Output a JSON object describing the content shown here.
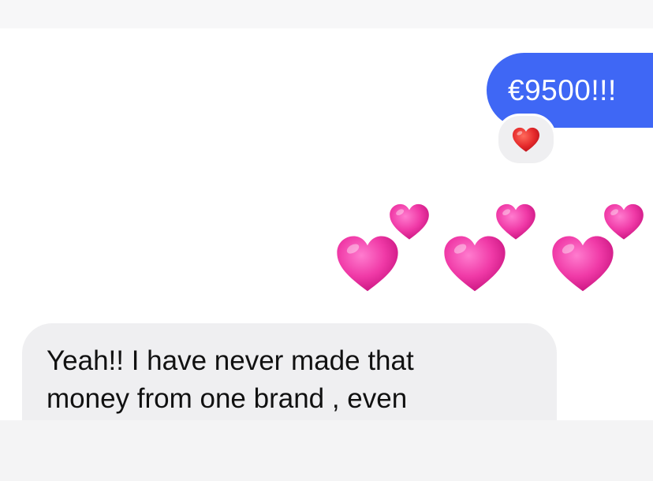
{
  "conversation": {
    "sent_message": {
      "text": "€9500!!!",
      "reaction": "red-heart"
    },
    "emoji_message": {
      "emoji": "pink-hearts",
      "count": 3
    },
    "received_message": {
      "line1": "Yeah!! I have never made that",
      "line2": "money from one brand , even"
    }
  },
  "colors": {
    "sent_bubble": "#3f67f5",
    "received_bubble": "#efeff1",
    "heart_pink": "#ee2f9e",
    "reaction_red": "#e0262b"
  },
  "icons": {
    "reaction": "red-heart-icon",
    "hearts": "two-hearts-icon"
  }
}
